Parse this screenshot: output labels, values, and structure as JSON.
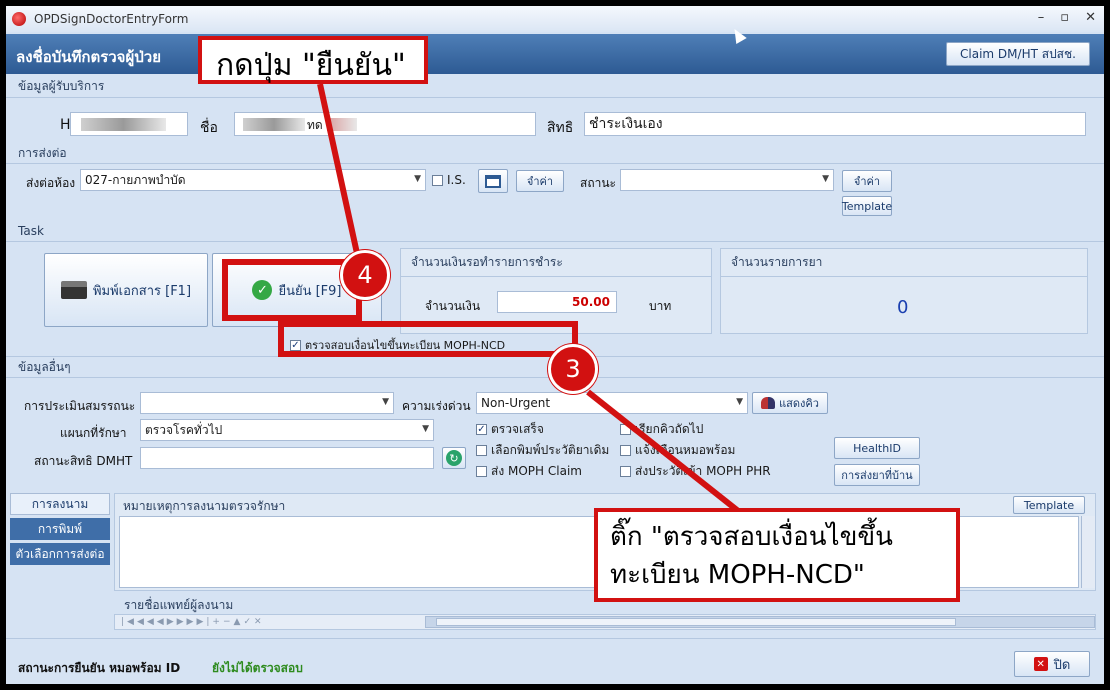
{
  "window": {
    "title": "OPDSignDoctorEntryForm",
    "header_title": "ลงชื่อบันทึกตรวจผู้ป่วย",
    "claim_button": "Claim DM/HT สปสช."
  },
  "service_recipient": {
    "section": "ข้อมูลผู้รับบริการ",
    "hn_label": "HN",
    "name_label": "ชื่อ",
    "name_suffix": "ทด",
    "rights_label": "สิทธิ",
    "rights_value": "ชำระเงินเอง"
  },
  "referral": {
    "section": "การส่งต่อ",
    "room_label": "ส่งต่อห้อง",
    "room_value": "027-กายภาพบำบัด",
    "is_label": "I.S.",
    "remember1": "จำค่า",
    "status_label": "สถานะ",
    "status_value": "",
    "remember2": "จำค่า",
    "template": "Template"
  },
  "task": {
    "section": "Task",
    "print_button": "พิมพ์เอกสาร [F1]",
    "confirm_button": "ยืนยัน [F9]",
    "pending_panel": "จำนวนเงินรอทำรายการชำระ",
    "amount_label": "จำนวนเงิน",
    "amount_value": "50.00",
    "currency": "บาท",
    "drug_panel": "จำนวนรายการยา",
    "drug_count": "0",
    "moph_ncd": "ตรวจสอบเงื่อนไขขึ้นทะเบียน MOPH-NCD"
  },
  "other": {
    "section": "ข้อมูลอื่นๆ",
    "assess_label": "การประเมินสมรรถนะ",
    "assess_value": "",
    "urgency_label": "ความเร่งด่วน",
    "urgency_value": "Non-Urgent",
    "show_queue": "แสดงคิว",
    "dept_label": "แผนกที่รักษา",
    "dept_value": "ตรวจโรคทั่วไป",
    "dmht_label": "สถานะสิทธิ DMHT",
    "chk_done": "ตรวจเสร็จ",
    "chk_next_queue": "เรียกคิวถัดไป",
    "chk_print_history": "เลือกพิมพ์ประวัติยาเดิม",
    "chk_notify_doctor": "แจ้งเตือนหมอพร้อม",
    "chk_moph_claim": "ส่ง MOPH Claim",
    "chk_moph_phr": "ส่งประวัติเข้า MOPH PHR",
    "health_id": "HealthID",
    "home_drug": "การส่งยาที่บ้าน"
  },
  "tabs": [
    "การลงนาม",
    "การพิมพ์",
    "ตัวเลือกการส่งต่อ"
  ],
  "notes": {
    "header": "หมายเหตุการลงนามตรวจรักษา",
    "template": "Template",
    "doctor_list": "รายชื่อแพทย์ผู้ลงนาม"
  },
  "footer": {
    "status_label": "สถานะการยืนยัน หมอพร้อม ID",
    "status_value": "ยังไม่ได้ตรวจสอบ",
    "close": "ปิด"
  },
  "annotations": {
    "top_callout": "กดปุ่ม \"ยืนยัน\"",
    "step4": "4",
    "step3": "3",
    "bottom_callout_line1": "ติ๊ก \"ตรวจสอบเงื่อนไขขึ้น",
    "bottom_callout_line2": "ทะเบียน MOPH-NCD\""
  },
  "colors": {
    "annotation_red": "#d21111",
    "header_blue": "#2d5a93",
    "amount_red": "#cc0000",
    "drug_count_blue": "#1a3fb0",
    "status_green": "#2e8b1e"
  }
}
